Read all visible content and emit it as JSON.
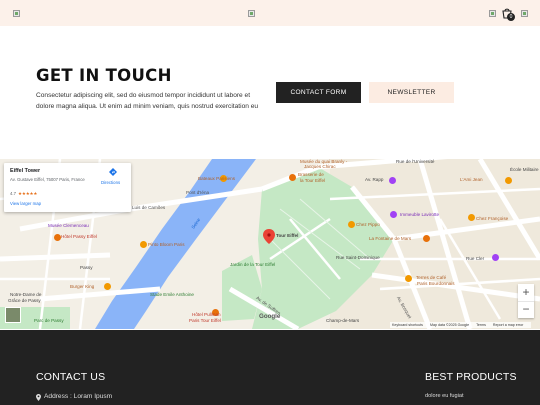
{
  "header": {
    "cart_count": "0",
    "icons": [
      "logo-image",
      "center-image",
      "search-image",
      "cart-icon",
      "account-image"
    ]
  },
  "contact": {
    "title": "GET IN TOUCH",
    "description": "Consectetur adipiscing elit, sed do eiusmod tempor incididunt ut labore et dolore magna aliqua. Ut enim ad minim veniam, quis nostrud exercitation eu",
    "contact_form_label": "CONTACT FORM",
    "newsletter_label": "NEWSLETTER"
  },
  "map": {
    "place_name": "Eiffel Tower",
    "address": "Av. Gustave Eiffel, 75007 Paris, France",
    "rating": "4.7",
    "stars": "★★★★★",
    "larger_map_label": "View larger map",
    "directions_label": "Directions",
    "zoom_in": "+",
    "zoom_out": "−",
    "google_logo": "Google",
    "attribution": [
      "Keyboard shortcuts",
      "Map data ©2025 Google",
      "Terms",
      "Report a map error"
    ],
    "labels": {
      "musee_quai": "Musée du quai Branly -",
      "jacques_chirac": "Jacques Chirac",
      "brasserie": "Brasserie de",
      "la_tour_eiffel": "la Tour Eiffel",
      "rue_universite": "Rue de l'Université",
      "av_rapp": "Av. Rapp",
      "ecole_militaire": "École Militaire",
      "lami_jean": "L'Ami Jean",
      "bateaux": "Bateaux Parisiens",
      "pont_iena": "Pont d'Iéna",
      "luis_camoens": "Luis de Camões",
      "seine": "Seine",
      "tour_eiffel": "Tour Eiffel",
      "chez_pippo": "Chez Pippo",
      "immeuble_lavirotte": "Immeuble Lavirotte",
      "chez_francoise": "Chez Françoise",
      "musee_clemenceau": "Musée Clemenceau",
      "hotel_passy": "Hôtel Passy Eiffel",
      "pinto_bloom": "Pinto Bloom Paris",
      "passy": "Passy",
      "jardin_tour_eiffel": "Jardin de la Tour Eiffel",
      "fontaine_mars": "La Fontaine de Mars",
      "rue_saint_dominique": "Rue Saint-Dominique",
      "rue_cler": "Rue Cler",
      "burger_king": "Burger King",
      "terres_cafe": "Terres de Café",
      "paris_bourdonnais": "Paris Bourdonnais",
      "notre_dame": "Notre-Dame de",
      "grace_passy": "Grâce de Passy",
      "stade_emile": "Stade Emile Anthoine",
      "hotel_pullman": "Hôtel Pullman",
      "paris_tour_eiffel": "Paris Tour Eiffel",
      "champ_mars": "Champ-de-Mars",
      "parc_passy": "Parc de Passy",
      "av_de_suffren": "Av. de Suffren",
      "av_bosquet": "Av. Bosquet"
    }
  },
  "footer": {
    "contact_title": "CONTACT US",
    "address": "Address : Loram Ipusm",
    "best_products_title": "BEST PRODUCTS",
    "product_1": "dolore eu fugiat"
  }
}
